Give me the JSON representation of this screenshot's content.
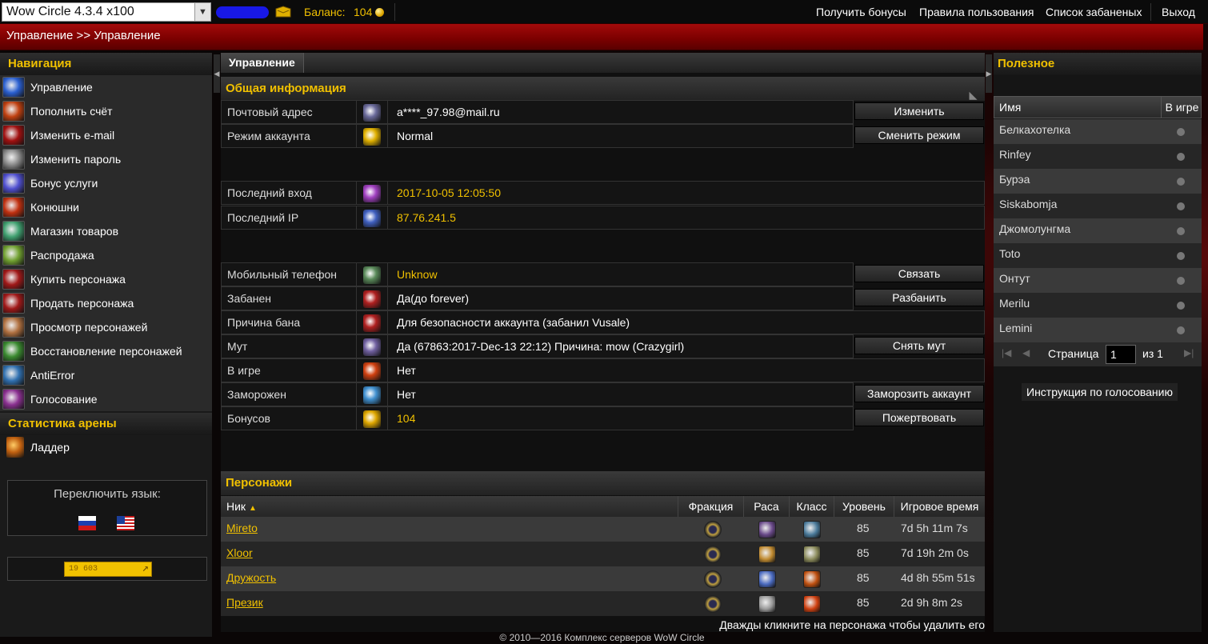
{
  "topbar": {
    "server": "Wow Circle 4.3.4 x100",
    "balance_label": "Баланс:",
    "balance_value": "104",
    "links": [
      "Получить бонусы",
      "Правила пользования",
      "Список забаненых",
      "Выход"
    ]
  },
  "breadcrumb": "Управление >> Управление",
  "nav": {
    "title": "Навигация",
    "items": [
      {
        "label": "Управление",
        "icon": "control-panel-icon",
        "color": "#2a5fd0"
      },
      {
        "label": "Пополнить счёт",
        "icon": "top-up-icon",
        "color": "#c04010"
      },
      {
        "label": "Изменить e-mail",
        "icon": "change-email-icon",
        "color": "#a01010"
      },
      {
        "label": "Изменить пароль",
        "icon": "change-password-icon",
        "color": "#8a8a8a"
      },
      {
        "label": "Бонус услуги",
        "icon": "bonus-services-icon",
        "color": "#5050d0"
      },
      {
        "label": "Конюшни",
        "icon": "stables-icon",
        "color": "#c03010"
      },
      {
        "label": "Магазин товаров",
        "icon": "shop-icon",
        "color": "#40a070"
      },
      {
        "label": "Распродажа",
        "icon": "sale-icon",
        "color": "#70a030"
      },
      {
        "label": "Купить персонажа",
        "icon": "buy-character-icon",
        "color": "#a01818"
      },
      {
        "label": "Продать персонажа",
        "icon": "sell-character-icon",
        "color": "#a01818"
      },
      {
        "label": "Просмотр персонажей",
        "icon": "view-characters-icon",
        "color": "#b07040"
      },
      {
        "label": "Восстановление персонажей",
        "icon": "restore-characters-icon",
        "color": "#3a8a30"
      },
      {
        "label": "AntiError",
        "icon": "antierror-icon",
        "color": "#3070b0"
      },
      {
        "label": "Голосование",
        "icon": "voting-icon",
        "color": "#8a3090"
      }
    ],
    "arena_title": "Статистика арены",
    "arena_items": [
      {
        "label": "Ладдер",
        "icon": "ladder-icon",
        "color": "#c06010"
      }
    ]
  },
  "language": {
    "label": "Переключить язык:"
  },
  "counter": {
    "value": "19 603"
  },
  "main": {
    "tab": "Управление",
    "general_title": "Общая информация",
    "info_rows": [
      {
        "label": "Почтовый адрес",
        "value": "a****_97.98@mail.ru",
        "icon": "mail-icon",
        "color": "#6a6a9a",
        "button": "Изменить",
        "gold": false
      },
      {
        "label": "Режим аккаунта",
        "value": "Normal",
        "icon": "star-icon",
        "color": "#e0b000",
        "button": "Сменить режим",
        "gold": false
      },
      {
        "label": "Последний вход",
        "value": "2017-10-05 12:05:50",
        "icon": "last-login-icon",
        "color": "#a040c0",
        "button": "",
        "gold": true
      },
      {
        "label": "Последний IP",
        "value": "87.76.241.5",
        "icon": "ip-icon",
        "color": "#4060c0",
        "button": "",
        "gold": true
      },
      {
        "label": "Мобильный телефон",
        "value": "Unknow",
        "icon": "phone-icon",
        "color": "#5a8a5a",
        "button": "Связать",
        "gold": true
      },
      {
        "label": "Забанен",
        "value": "Да(до forever)",
        "icon": "ban-icon",
        "color": "#b02020",
        "button": "Разбанить",
        "gold": false
      },
      {
        "label": "Причина бана",
        "value": "Для безопасности аккаунта (забанил Vusale)",
        "icon": "ban-reason-icon",
        "color": "#b02020",
        "button": "",
        "gold": false
      },
      {
        "label": "Мут",
        "value": "Да (67863:2017-Dec-13 22:12) Причина: mow (Crazygirl)",
        "icon": "mute-icon",
        "color": "#7060a0",
        "button": "Снять мут",
        "gold": false
      },
      {
        "label": "В игре",
        "value": "Нет",
        "icon": "in-game-icon",
        "color": "#d04010",
        "button": "",
        "gold": false
      },
      {
        "label": "Заморожен",
        "value": "Нет",
        "icon": "frozen-icon",
        "color": "#4090d0",
        "button": "Заморозить аккаунт",
        "gold": false
      },
      {
        "label": "Бонусов",
        "value": "104",
        "icon": "coin-icon",
        "color": "#e0a800",
        "button": "Пожертвовать",
        "gold": true
      }
    ],
    "chars_title": "Персонажи",
    "chars_columns": [
      "Ник",
      "Фракция",
      "Раса",
      "Класс",
      "Уровень",
      "Игровое время"
    ],
    "characters": [
      {
        "name": "Mireto",
        "level": "85",
        "time": "7d 5h 11m 7s",
        "race_color": "#6a4a8a",
        "class_color": "#4a7a9a"
      },
      {
        "name": "Xloor",
        "level": "85",
        "time": "7d 19h 2m 0s",
        "race_color": "#c08a30",
        "class_color": "#8a8a5a"
      },
      {
        "name": "Дружость",
        "level": "85",
        "time": "4d 8h 55m 51s",
        "race_color": "#4a6ac0",
        "class_color": "#c05010"
      },
      {
        "name": "Презик",
        "level": "85",
        "time": "2d 9h 8m 2s",
        "race_color": "#9a9a9a",
        "class_color": "#d04010"
      }
    ],
    "dblclick_note": "Дважды кликните на персонажа чтобы удалить его"
  },
  "useful": {
    "title": "Полезное",
    "col_name": "Имя",
    "col_ingame": "В игре",
    "players": [
      "Белкахотелка",
      "Rinfey",
      "Бурэа",
      "Siskabomja",
      "Джомолунгма",
      "Toto",
      "Онтут",
      "Merilu",
      "Lemini"
    ],
    "page_label": "Страница",
    "page_value": "1",
    "page_of": "из 1",
    "vote_guide": "Инструкция по голосованию"
  },
  "footer": "© 2010—2016 Комплекс серверов WoW Circle"
}
